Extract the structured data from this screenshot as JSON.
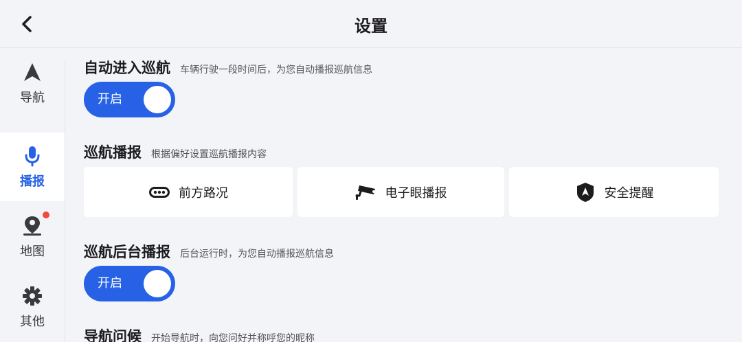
{
  "header": {
    "title": "设置",
    "back_icon": "chevron-left-icon"
  },
  "sidebar": {
    "items": [
      {
        "label": "导航",
        "icon": "navigation-arrow-icon"
      },
      {
        "label": "播报",
        "icon": "microphone-icon",
        "active": true
      },
      {
        "label": "地图",
        "icon": "map-pin-person-icon",
        "badge": "red-dot"
      },
      {
        "label": "其他",
        "icon": "gear-icon"
      }
    ]
  },
  "sections": {
    "auto_cruise": {
      "title": "自动进入巡航",
      "desc": "车辆行驶一段时间后，为您自动播报巡航信息",
      "toggle_label": "开启"
    },
    "cruise_broadcast": {
      "title": "巡航播报",
      "desc": "根据偏好设置巡航播报内容",
      "options": [
        {
          "label": "前方路况",
          "icon": "traffic-light-icon"
        },
        {
          "label": "电子眼播报",
          "icon": "camera-icon"
        },
        {
          "label": "安全提醒",
          "icon": "shield-icon"
        }
      ]
    },
    "background_broadcast": {
      "title": "巡航后台播报",
      "desc": "后台运行时，为您自动播报巡航信息",
      "toggle_label": "开启"
    },
    "nav_greeting": {
      "title": "导航问候",
      "desc": "开始导航时，向您问好并称呼您的昵称"
    }
  },
  "colors": {
    "accent": "#2762e6",
    "background": "#f3f4f8",
    "card": "#ffffff",
    "badge": "#ef4b3f"
  }
}
